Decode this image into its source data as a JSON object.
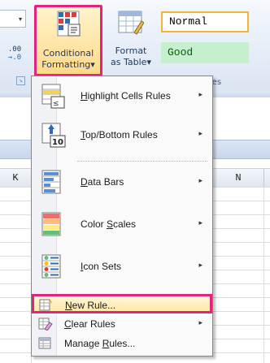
{
  "ribbon": {
    "decimal_label_top": ".00",
    "decimal_label_bottom": "→.0",
    "conditional_formatting": {
      "line1": "Conditional",
      "line2": "Formatting",
      "caret": "▾"
    },
    "format_as_table": {
      "line1": "Format",
      "line2": "as Table",
      "caret": "▾"
    },
    "styles": {
      "normal": "Normal",
      "good": "Good",
      "group_label": "les"
    },
    "accent_color": "#e4237a"
  },
  "grid": {
    "columns": [
      "K",
      "N"
    ]
  },
  "menu": {
    "items": [
      {
        "label_underlined": "H",
        "label_rest": "ighlight Cells Rules",
        "icon": "highlight-cells-icon",
        "has_submenu": true
      },
      {
        "label_underlined": "T",
        "label_rest": "op/Bottom Rules",
        "icon": "top-bottom-icon",
        "has_submenu": true
      },
      {
        "label_underlined": "D",
        "label_rest": "ata Bars",
        "icon": "data-bars-icon",
        "has_submenu": true
      },
      {
        "label_pre": "Color ",
        "label_underlined": "S",
        "label_rest": "cales",
        "icon": "color-scales-icon",
        "has_submenu": true
      },
      {
        "label_underlined": "I",
        "label_rest": "con Sets",
        "icon": "icon-sets-icon",
        "has_submenu": true
      }
    ],
    "small_items": [
      {
        "label_underlined": "N",
        "label_rest": "ew Rule...",
        "icon": "new-rule-icon",
        "has_submenu": false,
        "highlighted": true
      },
      {
        "label_underlined": "C",
        "label_rest": "lear Rules",
        "icon": "clear-rules-icon",
        "has_submenu": true
      },
      {
        "label_pre": "Manage ",
        "label_underlined": "R",
        "label_rest": "ules...",
        "icon": "manage-rules-icon",
        "has_submenu": false
      }
    ],
    "submenu_arrow": "▸"
  }
}
